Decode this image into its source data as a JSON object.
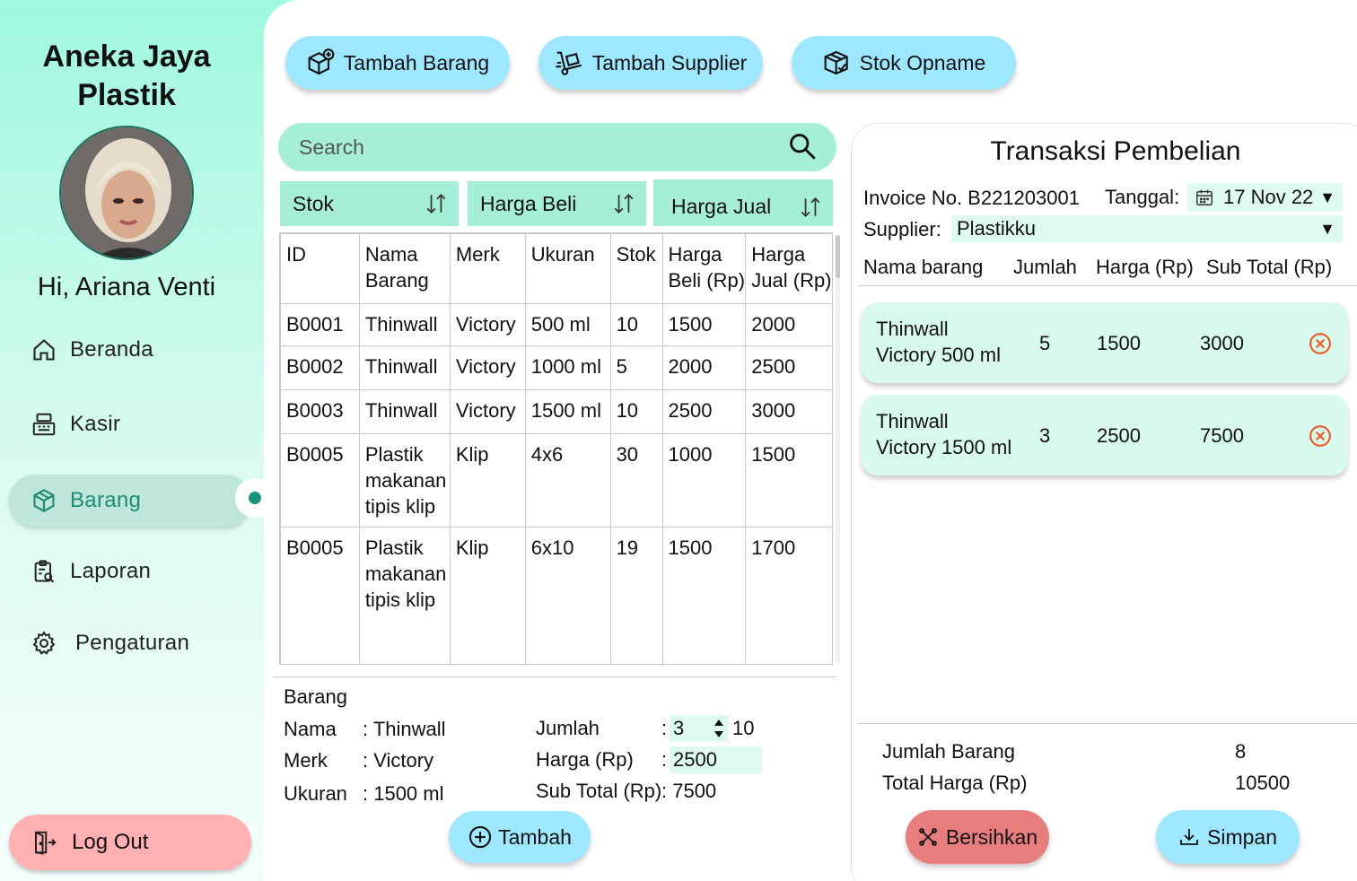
{
  "sidebar": {
    "brand": "Aneka Jaya Plastik",
    "greeting": "Hi, Ariana Venti",
    "items": [
      {
        "label": "Beranda",
        "icon": "home-icon"
      },
      {
        "label": "Kasir",
        "icon": "cash-register-icon"
      },
      {
        "label": "Barang",
        "icon": "box-icon",
        "active": true
      },
      {
        "label": "Laporan",
        "icon": "report-icon"
      },
      {
        "label": "Pengaturan",
        "icon": "gear-icon"
      }
    ],
    "logout_label": "Log Out"
  },
  "toolbar": {
    "add_item_label": "Tambah Barang",
    "add_supplier_label": "Tambah Supplier",
    "stock_opname_label": "Stok Opname"
  },
  "search": {
    "placeholder": "Search"
  },
  "sort_buttons": [
    "Stok",
    "Harga Beli",
    "Harga Jual"
  ],
  "items_table": {
    "headers": [
      "ID",
      "Nama Barang",
      "Merk",
      "Ukuran",
      "Stok",
      "Harga Beli (Rp)",
      "Harga Jual (Rp)"
    ],
    "rows": [
      [
        "B0001",
        "Thinwall",
        "Victory",
        "500 ml",
        "10",
        "1500",
        "2000"
      ],
      [
        "B0002",
        "Thinwall",
        "Victory",
        "1000 ml",
        "5",
        "2000",
        "2500"
      ],
      [
        "B0003",
        "Thinwall",
        "Victory",
        "1500 ml",
        "10",
        "2500",
        "3000"
      ],
      [
        "B0005",
        "Plastik makanan tipis klip",
        "Klip",
        "4x6",
        "30",
        "1000",
        "1500"
      ],
      [
        "B0005",
        "Plastik makanan tipis klip",
        "Klip",
        "6x10",
        "19",
        "1500",
        "1700"
      ]
    ]
  },
  "detail": {
    "title": "Barang",
    "nama_label": "Nama",
    "nama_value": ": Thinwall",
    "merk_label": "Merk",
    "merk_value": ": Victory",
    "ukuran_label": "Ukuran",
    "ukuran_value": ": 1500 ml",
    "jumlah_label": "Jumlah",
    "jumlah_value": "3",
    "jumlah_max": "10",
    "harga_label": "Harga  (Rp)",
    "harga_value": "2500",
    "subtotal_label": "Sub Total (Rp)",
    "subtotal_value": ": 7500",
    "colon": ":",
    "add_label": "Tambah"
  },
  "transaction": {
    "title": "Transaksi Pembelian",
    "invoice_text": "Invoice No. B221203001",
    "date_label": "Tanggal:",
    "date_value": "17 Nov 22",
    "supplier_label": "Supplier:",
    "supplier_value": "Plastikku",
    "headers": [
      "Nama barang",
      "Jumlah",
      "Harga (Rp)",
      "Sub Total (Rp)"
    ],
    "items": [
      {
        "name_line1": "Thinwall",
        "name_line2": "Victory 500 ml",
        "qty": "5",
        "price": "1500",
        "subtotal": "3000"
      },
      {
        "name_line1": "Thinwall",
        "name_line2": "Victory 1500 ml",
        "qty": "3",
        "price": "2500",
        "subtotal": "7500"
      }
    ],
    "total_items_label": "Jumlah Barang",
    "total_items_value": "8",
    "total_price_label": "Total Harga (Rp)",
    "total_price_value": "10500",
    "clear_label": "Bersihkan",
    "save_label": "Simpan"
  },
  "colors": {
    "accent_mint": "#a5eed8",
    "accent_blue": "#9ee8ff",
    "active_green": "#17967a",
    "logout_pink": "#ffb1b1",
    "clear_red": "#e87d7d",
    "remove_orange": "#f05a28"
  }
}
